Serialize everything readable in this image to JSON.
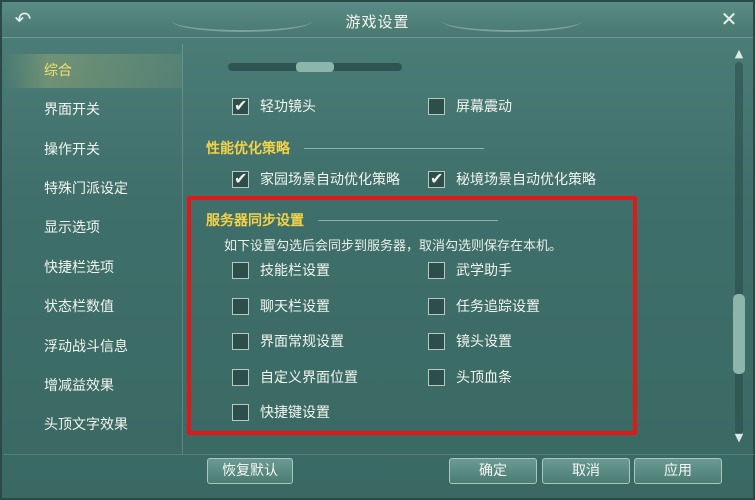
{
  "window": {
    "title": "游戏设置"
  },
  "icons": {
    "back": "back-arrow-icon",
    "close": "close-icon",
    "check": "check-icon"
  },
  "sidebar": {
    "items": [
      {
        "label": "综合",
        "active": true
      },
      {
        "label": "界面开关",
        "active": false
      },
      {
        "label": "操作开关",
        "active": false
      },
      {
        "label": "特殊门派设定",
        "active": false
      },
      {
        "label": "显示选项",
        "active": false
      },
      {
        "label": "快捷栏选项",
        "active": false
      },
      {
        "label": "状态栏数值",
        "active": false
      },
      {
        "label": "浮动战斗信息",
        "active": false
      },
      {
        "label": "增减益效果",
        "active": false
      },
      {
        "label": "头顶文字效果",
        "active": false
      }
    ]
  },
  "content": {
    "top_row": {
      "left": {
        "label": "轻功镜头",
        "checked": true
      },
      "right": {
        "label": "屏幕震动",
        "checked": false
      }
    },
    "performance": {
      "title": "性能优化策略",
      "left": {
        "label": "家园场景自动优化策略",
        "checked": true
      },
      "right": {
        "label": "秘境场景自动优化策略",
        "checked": true
      }
    },
    "server_sync": {
      "title": "服务器同步设置",
      "note": "如下设置勾选后会同步到服务器，取消勾选则保存在本机。",
      "options": [
        {
          "label": "技能栏设置",
          "checked": false
        },
        {
          "label": "武学助手",
          "checked": false
        },
        {
          "label": "聊天栏设置",
          "checked": false
        },
        {
          "label": "任务追踪设置",
          "checked": false
        },
        {
          "label": "界面常规设置",
          "checked": false
        },
        {
          "label": "镜头设置",
          "checked": false
        },
        {
          "label": "自定义界面位置",
          "checked": false
        },
        {
          "label": "头顶血条",
          "checked": false
        },
        {
          "label": "快捷键设置",
          "checked": false
        }
      ]
    }
  },
  "footer": {
    "reset": "恢复默认",
    "confirm": "确定",
    "cancel": "取消",
    "apply": "应用"
  },
  "colors": {
    "accent_yellow": "#f2d24a",
    "highlight_red": "#e01818",
    "panel_bg": "#3f6f6a"
  }
}
